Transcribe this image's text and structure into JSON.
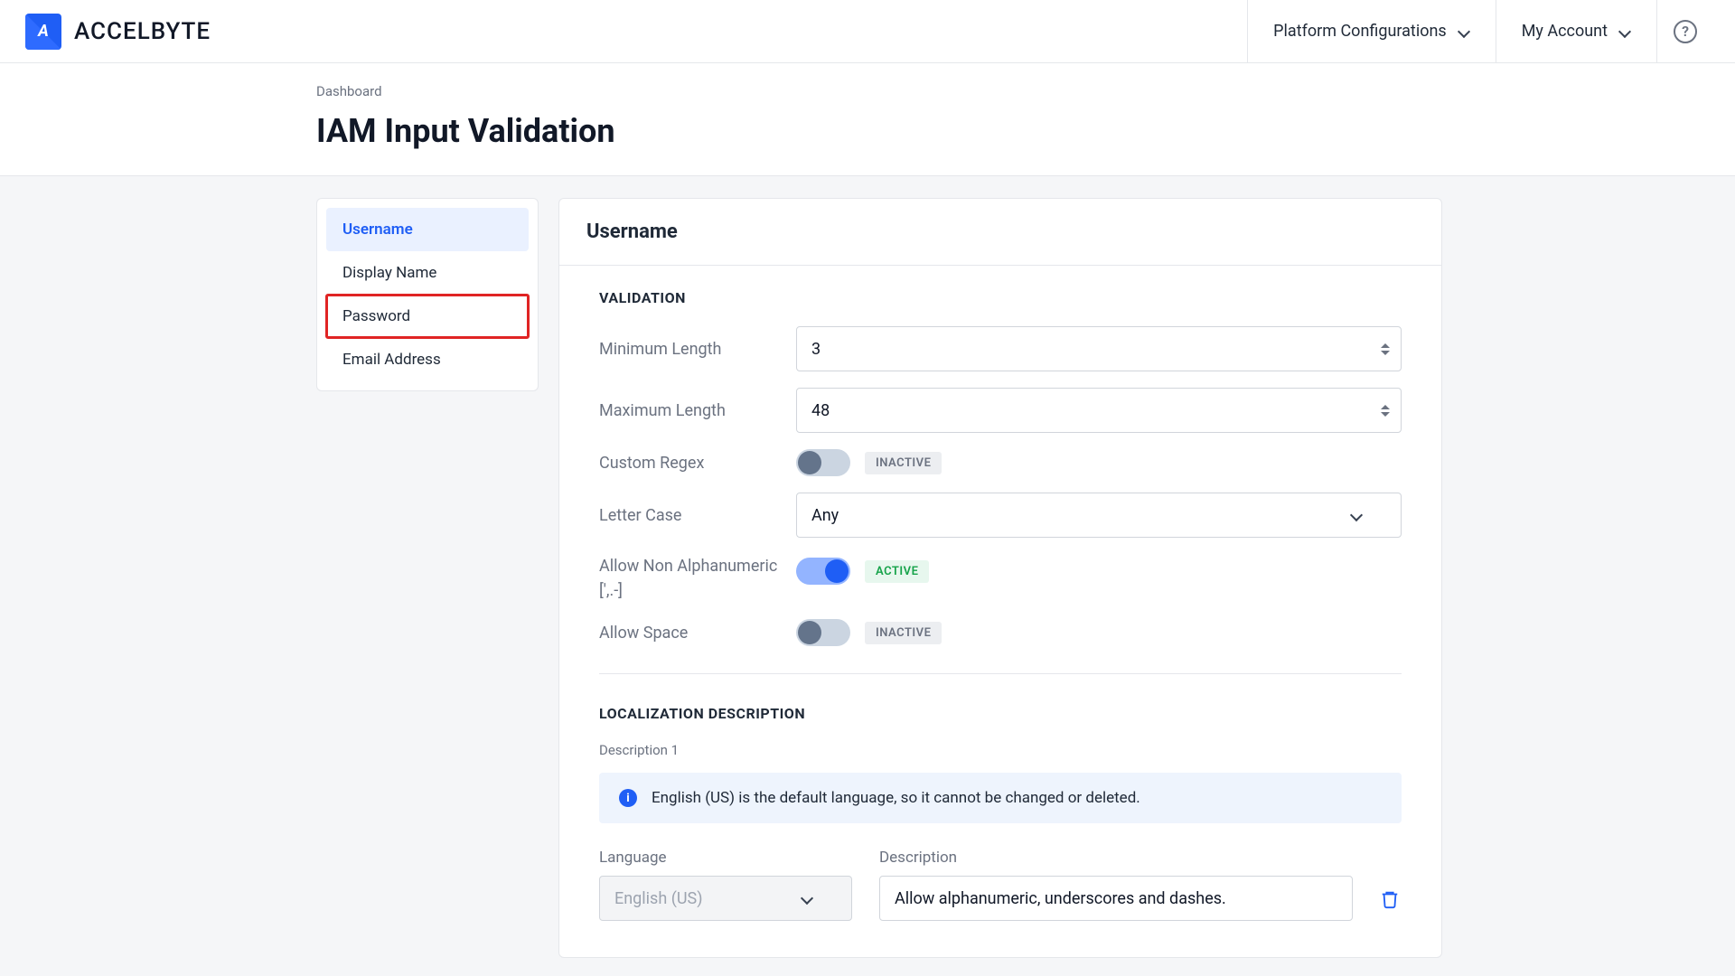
{
  "brand": {
    "mark": "A",
    "name": "ACCELBYTE"
  },
  "topbar": {
    "platform": "Platform Configurations",
    "account": "My Account"
  },
  "breadcrumb": "Dashboard",
  "page_title": "IAM Input Validation",
  "sidebar": {
    "items": [
      {
        "label": "Username",
        "active": true
      },
      {
        "label": "Display Name"
      },
      {
        "label": "Password",
        "highlight": true
      },
      {
        "label": "Email Address"
      }
    ]
  },
  "panel": {
    "heading": "Username",
    "validation_title": "VALIDATION",
    "min_label": "Minimum Length",
    "min_value": "3",
    "max_label": "Maximum Length",
    "max_value": "48",
    "regex_label": "Custom Regex",
    "regex_badge": "INACTIVE",
    "lettercase_label": "Letter Case",
    "lettercase_value": "Any",
    "nonalpha_label": "Allow Non Alphanumeric [',.-]",
    "nonalpha_badge": "ACTIVE",
    "space_label": "Allow Space",
    "space_badge": "INACTIVE"
  },
  "localization": {
    "title": "LOCALIZATION DESCRIPTION",
    "sub": "Description 1",
    "banner": "English (US) is the default language, so it cannot be changed or deleted.",
    "lang_label": "Language",
    "lang_value": "English (US)",
    "desc_label": "Description",
    "desc_value": "Allow alphanumeric, underscores and dashes."
  }
}
